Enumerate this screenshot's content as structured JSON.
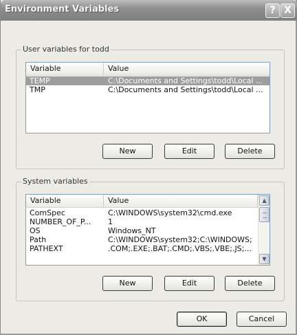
{
  "window": {
    "title": "Environment Variables",
    "help_glyph": "?",
    "close_glyph": "X"
  },
  "user_vars": {
    "group_label": "User variables for todd",
    "columns": {
      "variable": "Variable",
      "value": "Value"
    },
    "rows": [
      {
        "variable": "TEMP",
        "value": "C:\\Documents and Settings\\todd\\Local ...",
        "selected": true
      },
      {
        "variable": "TMP",
        "value": "C:\\Documents and Settings\\todd\\Local ...",
        "selected": false
      }
    ],
    "buttons": {
      "new": "New",
      "edit": "Edit",
      "delete": "Delete"
    }
  },
  "system_vars": {
    "group_label": "System variables",
    "columns": {
      "variable": "Variable",
      "value": "Value"
    },
    "rows": [
      {
        "variable": "ComSpec",
        "value": "C:\\WINDOWS\\system32\\cmd.exe",
        "selected": false
      },
      {
        "variable": "NUMBER_OF_P...",
        "value": "1",
        "selected": false
      },
      {
        "variable": "OS",
        "value": "Windows_NT",
        "selected": false
      },
      {
        "variable": "Path",
        "value": "C:\\WINDOWS\\system32;C:\\WINDOWS;...",
        "selected": false
      },
      {
        "variable": "PATHEXT",
        "value": ".COM;.EXE;.BAT;.CMD;.VBS;.VBE;.JS;....",
        "selected": false
      }
    ],
    "buttons": {
      "new": "New",
      "edit": "Edit",
      "delete": "Delete"
    }
  },
  "footer": {
    "ok": "OK",
    "cancel": "Cancel"
  },
  "colors": {
    "selection": "#9e9e9e",
    "titlebar": "#8e8e8e",
    "dialog_bg": "#ecebe6"
  },
  "icons": {
    "scroll_up": "scroll-up-arrow-icon",
    "scroll_down": "scroll-down-arrow-icon"
  }
}
